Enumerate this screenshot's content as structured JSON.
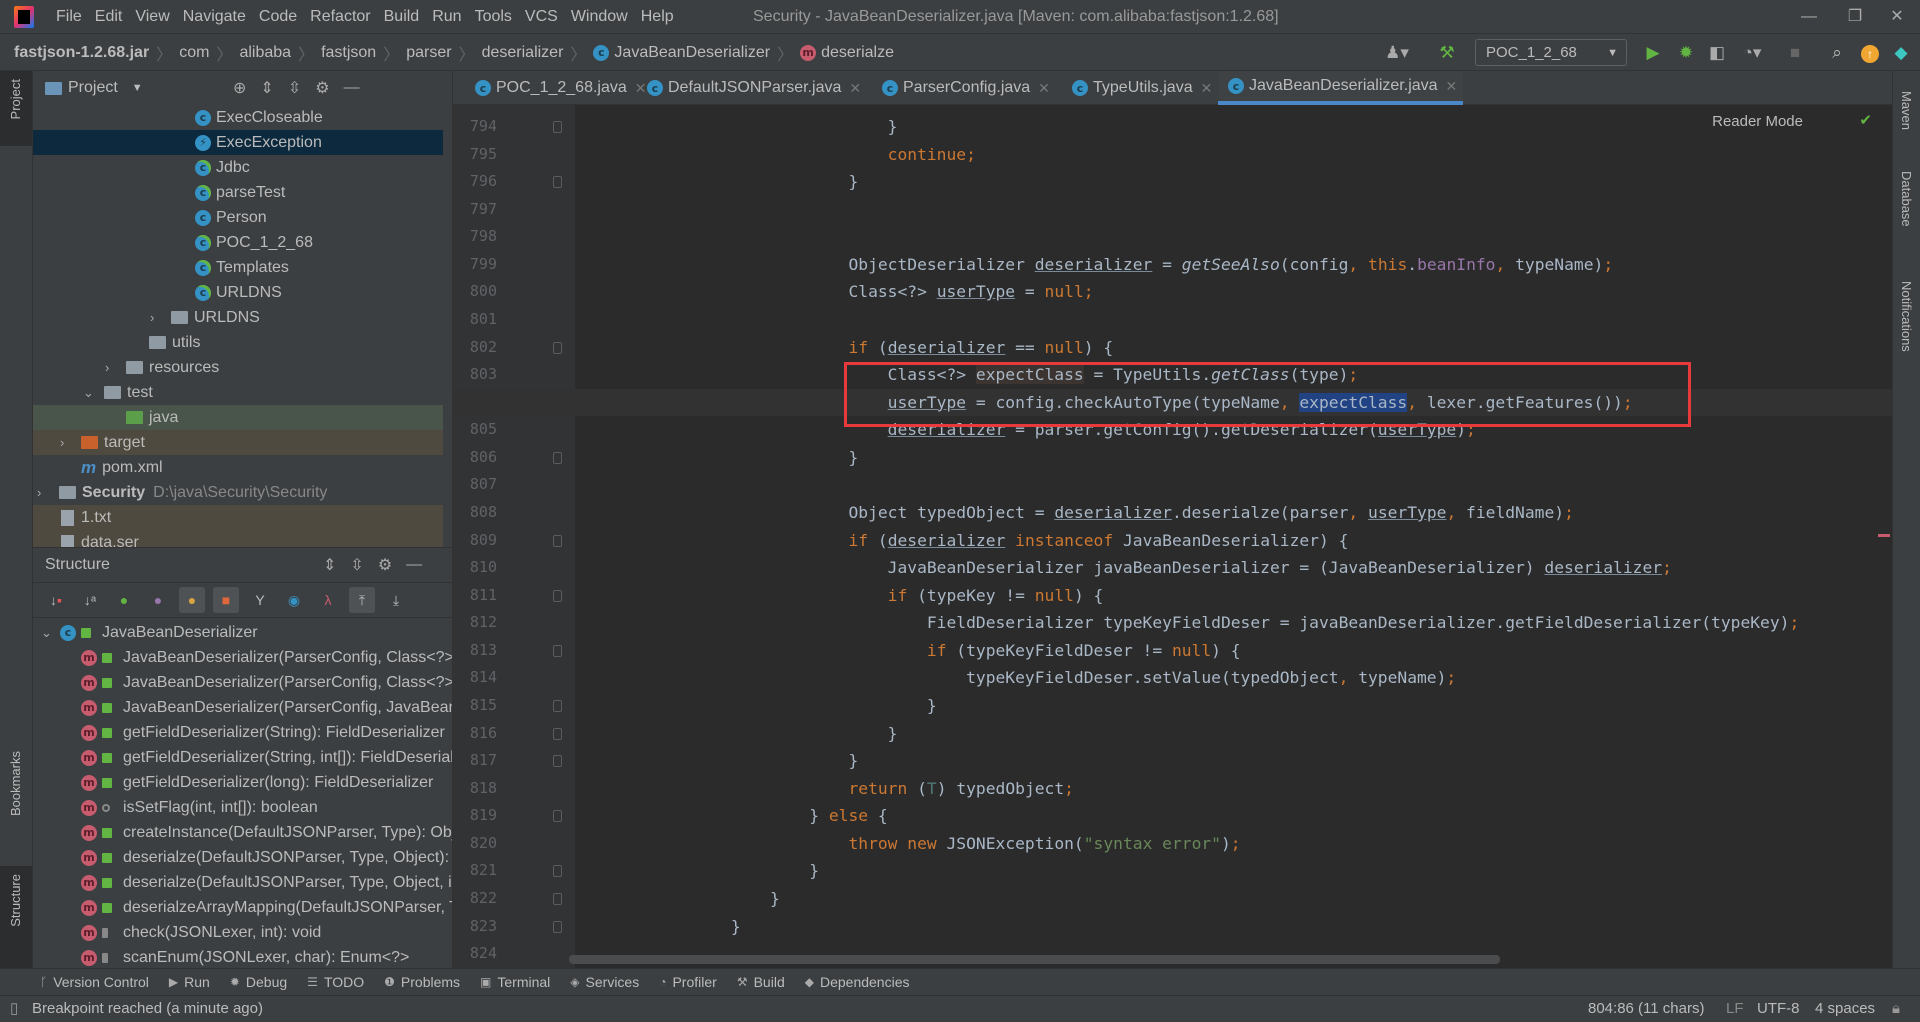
{
  "titlebar": {
    "menus": [
      "File",
      "Edit",
      "View",
      "Navigate",
      "Code",
      "Refactor",
      "Build",
      "Run",
      "Tools",
      "VCS",
      "Window",
      "Help"
    ],
    "title": "Security - JavaBeanDeserializer.java [Maven: com.alibaba:fastjson:1.2.68]",
    "minimize": "—",
    "restore": "❐",
    "close": "✕"
  },
  "navbar": {
    "crumbs": [
      "fastjson-1.2.68.jar",
      "com",
      "alibaba",
      "fastjson",
      "parser",
      "deserializer",
      "JavaBeanDeserializer",
      "deserialze"
    ],
    "class_icon": "c",
    "method_icon": "m",
    "run_config": "POC_1_2_68"
  },
  "left_strip": {
    "project": "Project",
    "bookmarks": "Bookmarks",
    "structure": "Structure"
  },
  "right_strip": {
    "maven": "Maven",
    "database": "Database",
    "notifications": "Notifications"
  },
  "project": {
    "title": "Project",
    "items": [
      {
        "label": "ExecCloseable",
        "type": "class"
      },
      {
        "label": "ExecException",
        "type": "exception",
        "selected": true
      },
      {
        "label": "Jdbc",
        "type": "runnable-class"
      },
      {
        "label": "parseTest",
        "type": "runnable-class"
      },
      {
        "label": "Person",
        "type": "class"
      },
      {
        "label": "POC_1_2_68",
        "type": "runnable-class"
      },
      {
        "label": "Templates",
        "type": "runnable-class"
      },
      {
        "label": "URLDNS",
        "type": "runnable-class"
      },
      {
        "label": "URLDNS",
        "type": "package",
        "collapsed": true
      },
      {
        "label": "utils",
        "type": "package"
      },
      {
        "label": "resources",
        "type": "resources-folder",
        "collapsed": true
      },
      {
        "label": "test",
        "type": "folder",
        "expanded": true
      },
      {
        "label": "java",
        "type": "test-source-folder"
      },
      {
        "label": "target",
        "type": "excluded-folder",
        "collapsed": true
      },
      {
        "label": "pom.xml",
        "type": "maven"
      },
      {
        "label": "Security",
        "type": "module",
        "collapsed": true,
        "path": "D:\\java\\Security\\Security"
      },
      {
        "label": "1.txt",
        "type": "file"
      },
      {
        "label": "data.ser",
        "type": "file"
      }
    ]
  },
  "structure": {
    "title": "Structure",
    "root": "JavaBeanDeserializer",
    "members": [
      "JavaBeanDeserializer(ParserConfig, Class<?>)",
      "JavaBeanDeserializer(ParserConfig, Class<?>, Type)",
      "JavaBeanDeserializer(ParserConfig, JavaBeanInfo)",
      "getFieldDeserializer(String): FieldDeserializer",
      "getFieldDeserializer(String, int[]): FieldDeserializer",
      "getFieldDeserializer(long): FieldDeserializer",
      "isSetFlag(int, int[]): boolean",
      "createInstance(DefaultJSONParser, Type): Object",
      "deserialze(DefaultJSONParser, Type, Object): T",
      "deserialze(DefaultJSONParser, Type, Object, int): T",
      "deserialzeArrayMapping(DefaultJSONParser, Type, Object, Object): T",
      "check(JSONLexer, int): void",
      "scanEnum(JSONLexer, char): Enum<?>"
    ],
    "member_visibility": [
      "public",
      "public",
      "public",
      "public",
      "public",
      "public",
      "package",
      "public",
      "public",
      "public",
      "public",
      "protected",
      "protected"
    ]
  },
  "tabs": [
    {
      "label": "POC_1_2_68.java",
      "active": false
    },
    {
      "label": "DefaultJSONParser.java",
      "active": false
    },
    {
      "label": "ParserConfig.java",
      "active": false
    },
    {
      "label": "TypeUtils.java",
      "active": false
    },
    {
      "label": "JavaBeanDeserializer.java",
      "active": true
    }
  ],
  "editor": {
    "reader_mode": "Reader Mode",
    "current_line": "804",
    "lines": [
      {
        "n": "794",
        "t": [
          [
            "                                }",
            ""
          ]
        ]
      },
      {
        "n": "795",
        "t": [
          [
            "                                ",
            ""
          ],
          [
            "continue",
            "k"
          ],
          [
            ";",
            "k"
          ]
        ]
      },
      {
        "n": "796",
        "t": [
          [
            "                            }",
            ""
          ]
        ]
      },
      {
        "n": "797",
        "t": []
      },
      {
        "n": "798",
        "t": []
      },
      {
        "n": "799",
        "t": [
          [
            "                            ObjectDeserializer ",
            ""
          ],
          [
            "deserializer",
            "u"
          ],
          [
            " = ",
            ""
          ],
          [
            "getSeeAlso",
            "i"
          ],
          [
            "(config",
            ""
          ],
          [
            ", ",
            "k"
          ],
          [
            "this",
            "k"
          ],
          [
            ".",
            ""
          ],
          [
            "beanInfo",
            "f"
          ],
          [
            ", ",
            "k"
          ],
          [
            "typeName)",
            ""
          ],
          [
            ";",
            "k"
          ]
        ]
      },
      {
        "n": "800",
        "t": [
          [
            "                            Class<?> ",
            ""
          ],
          [
            "userType",
            "u"
          ],
          [
            " = ",
            ""
          ],
          [
            "null",
            "k"
          ],
          [
            ";",
            "k"
          ]
        ]
      },
      {
        "n": "801",
        "t": []
      },
      {
        "n": "802",
        "t": [
          [
            "                            ",
            ""
          ],
          [
            "if",
            "k"
          ],
          [
            " (",
            ""
          ],
          [
            "deserializer",
            "u"
          ],
          [
            " == ",
            ""
          ],
          [
            "null",
            "k"
          ],
          [
            ") {",
            ""
          ]
        ]
      },
      {
        "n": "803",
        "t": [
          [
            "                                Class<?> ",
            ""
          ],
          [
            "expectClass",
            "h1"
          ],
          [
            " = TypeUtils.",
            ""
          ],
          [
            "getClass",
            "i"
          ],
          [
            "(type)",
            ""
          ],
          [
            ";",
            "k"
          ]
        ]
      },
      {
        "n": "804",
        "t": [
          [
            "                                ",
            ""
          ],
          [
            "userType",
            "u"
          ],
          [
            " = config.checkAutoType(typeName",
            ""
          ],
          [
            ", ",
            "k"
          ],
          [
            "expectClass",
            "sel"
          ],
          [
            ", ",
            "k"
          ],
          [
            "lexer.getFeatures())",
            ""
          ],
          [
            ";",
            "k"
          ]
        ]
      },
      {
        "n": "805",
        "t": [
          [
            "                                ",
            ""
          ],
          [
            "deserializer",
            "u"
          ],
          [
            " = parser.getConfig().getDeserializer(",
            ""
          ],
          [
            "userType",
            "u"
          ],
          [
            ")",
            ""
          ],
          [
            ";",
            "k"
          ]
        ]
      },
      {
        "n": "806",
        "t": [
          [
            "                            }",
            ""
          ]
        ]
      },
      {
        "n": "807",
        "t": []
      },
      {
        "n": "808",
        "t": [
          [
            "                            Object typedObject = ",
            ""
          ],
          [
            "deserializer",
            "u"
          ],
          [
            ".deserialze(parser",
            ""
          ],
          [
            ", ",
            "k"
          ],
          [
            "userType",
            "u"
          ],
          [
            ", ",
            "k"
          ],
          [
            "fieldName)",
            ""
          ],
          [
            ";",
            "k"
          ]
        ]
      },
      {
        "n": "809",
        "t": [
          [
            "                            ",
            ""
          ],
          [
            "if",
            "k"
          ],
          [
            " (",
            ""
          ],
          [
            "deserializer",
            "u"
          ],
          [
            " ",
            ""
          ],
          [
            "instanceof",
            "k"
          ],
          [
            " JavaBeanDeserializer) {",
            ""
          ]
        ]
      },
      {
        "n": "810",
        "t": [
          [
            "                                JavaBeanDeserializer javaBeanDeserializer = (JavaBeanDeserializer) ",
            ""
          ],
          [
            "deserializer",
            "u"
          ],
          [
            ";",
            "k"
          ]
        ]
      },
      {
        "n": "811",
        "t": [
          [
            "                                ",
            ""
          ],
          [
            "if",
            "k"
          ],
          [
            " (typeKey != ",
            ""
          ],
          [
            "null",
            "k"
          ],
          [
            ") {",
            ""
          ]
        ]
      },
      {
        "n": "812",
        "t": [
          [
            "                                    FieldDeserializer typeKeyFieldDeser = javaBeanDeserializer.getFieldDeserializer(typeKey)",
            ""
          ],
          [
            ";",
            "k"
          ]
        ]
      },
      {
        "n": "813",
        "t": [
          [
            "                                    ",
            ""
          ],
          [
            "if",
            "k"
          ],
          [
            " (typeKeyFieldDeser != ",
            ""
          ],
          [
            "null",
            "k"
          ],
          [
            ") {",
            ""
          ]
        ]
      },
      {
        "n": "814",
        "t": [
          [
            "                                        typeKeyFieldDeser.setValue(typedObject",
            ""
          ],
          [
            ", ",
            "k"
          ],
          [
            "typeName)",
            ""
          ],
          [
            ";",
            "k"
          ]
        ]
      },
      {
        "n": "815",
        "t": [
          [
            "                                    }",
            ""
          ]
        ]
      },
      {
        "n": "816",
        "t": [
          [
            "                                }",
            ""
          ]
        ]
      },
      {
        "n": "817",
        "t": [
          [
            "                            }",
            ""
          ]
        ]
      },
      {
        "n": "818",
        "t": [
          [
            "                            ",
            ""
          ],
          [
            "return",
            "k"
          ],
          [
            " (",
            ""
          ],
          [
            "T",
            "n"
          ],
          [
            ") typedObject",
            ""
          ],
          [
            ";",
            "k"
          ]
        ]
      },
      {
        "n": "819",
        "t": [
          [
            "                        } ",
            ""
          ],
          [
            "else",
            "k"
          ],
          [
            " {",
            ""
          ]
        ]
      },
      {
        "n": "820",
        "t": [
          [
            "                            ",
            ""
          ],
          [
            "throw new",
            "k"
          ],
          [
            " JSONException(",
            ""
          ],
          [
            "\"syntax error\"",
            "s"
          ],
          [
            ")",
            ""
          ],
          [
            ";",
            "k"
          ]
        ]
      },
      {
        "n": "821",
        "t": [
          [
            "                        }",
            ""
          ]
        ]
      },
      {
        "n": "822",
        "t": [
          [
            "                    }",
            ""
          ]
        ]
      },
      {
        "n": "823",
        "t": [
          [
            "                }",
            ""
          ]
        ]
      },
      {
        "n": "824",
        "t": []
      }
    ],
    "fold_lines": [
      "794",
      "796",
      "802",
      "806",
      "809",
      "811",
      "813",
      "815",
      "816",
      "817",
      "819",
      "821",
      "822",
      "823"
    ],
    "highlight_box_color": "#e8393c"
  },
  "bottom_tools": [
    "Version Control",
    "Run",
    "Debug",
    "TODO",
    "Problems",
    "Terminal",
    "Services",
    "Profiler",
    "Build",
    "Dependencies"
  ],
  "bottom_tool_icons": [
    "branch-icon",
    "play-icon",
    "bug-icon",
    "list-icon",
    "warning-icon",
    "terminal-icon",
    "services-icon",
    "profiler-icon",
    "hammer-icon",
    "dependencies-icon"
  ],
  "status": {
    "message": "Breakpoint reached (a minute ago)",
    "position": "804:86 (11 chars)",
    "line_sep": "LF",
    "encoding": "UTF-8",
    "indent": "4 spaces"
  }
}
